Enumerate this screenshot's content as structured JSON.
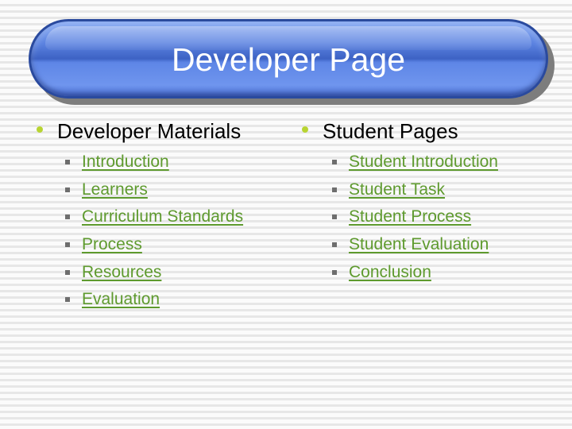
{
  "slide": {
    "title": "Developer Page",
    "colors": {
      "banner": "#4f74d6",
      "title_text": "#ffffff",
      "bullet": "#b8d432",
      "link": "#5e9a2e",
      "sub_bullet": "#6e6e6e"
    }
  },
  "sections": [
    {
      "heading": "Developer Materials",
      "bullet_icon": "round-bullet",
      "links": [
        {
          "label": "Introduction",
          "icon": "square-bullet"
        },
        {
          "label": "Learners",
          "icon": "square-bullet"
        },
        {
          "label": "Curriculum Standards",
          "icon": "square-bullet"
        },
        {
          "label": "Process",
          "icon": "square-bullet"
        },
        {
          "label": "Resources",
          "icon": "square-bullet"
        },
        {
          "label": "Evaluation",
          "icon": "square-bullet"
        }
      ]
    },
    {
      "heading": "Student Pages",
      "bullet_icon": "round-bullet",
      "links": [
        {
          "label": "Student Introduction",
          "icon": "square-bullet"
        },
        {
          "label": "Student Task",
          "icon": "square-bullet"
        },
        {
          "label": "Student Process",
          "icon": "square-bullet"
        },
        {
          "label": "Student Evaluation",
          "icon": "square-bullet"
        },
        {
          "label": "Conclusion",
          "icon": "square-bullet"
        }
      ]
    }
  ]
}
